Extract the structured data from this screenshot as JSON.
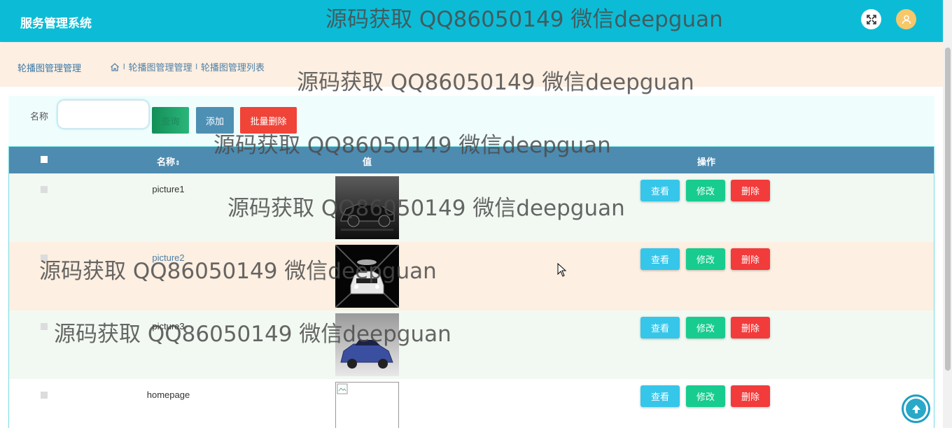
{
  "app": {
    "title": "服务管理系统"
  },
  "breadcrumb": {
    "section": "轮播图管理管理",
    "items": [
      "轮播图管理管理",
      "轮播图管理列表"
    ],
    "separator": "l"
  },
  "search": {
    "label": "名称",
    "value": "",
    "query_label": "查询",
    "add_label": "添加",
    "batch_delete_label": "批量删除"
  },
  "table": {
    "headers": {
      "name": "名称",
      "value": "值",
      "actions": "操作"
    },
    "rows": [
      {
        "name": "picture1",
        "image": "black-sedan"
      },
      {
        "name": "picture2",
        "image": "white-car-tunnel"
      },
      {
        "name": "picture3",
        "image": "blue-suv"
      },
      {
        "name": "homepage",
        "image": "broken-image"
      }
    ],
    "actions": {
      "view": "查看",
      "edit": "修改",
      "delete": "删除"
    }
  },
  "watermark": "源码获取 QQ86050149 微信deepguan",
  "colors": {
    "topbar": "#0cbcd6",
    "breadcrumb_bg": "#fdefe1",
    "table_header": "#4e8bb0",
    "view": "#36c6ea",
    "edit": "#17cc8e",
    "delete": "#f23b3b"
  }
}
